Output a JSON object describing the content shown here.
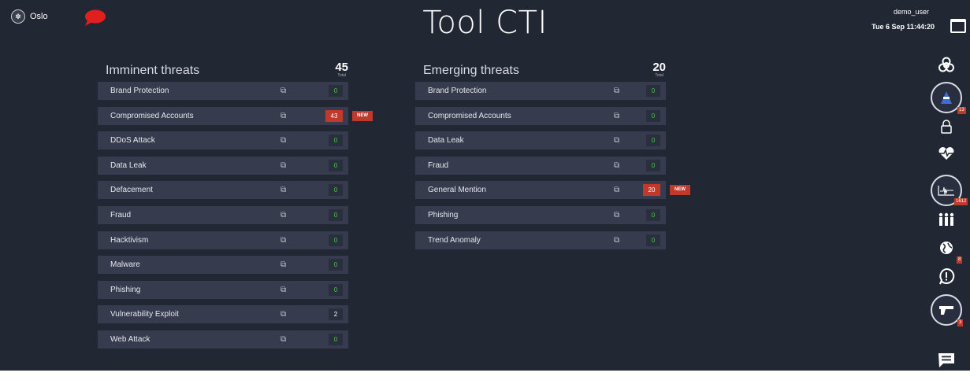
{
  "header": {
    "city": "Oslo",
    "title": "Tool CTI",
    "user": "demo_user",
    "datetime": "Tue 6 Sep 11:44:20"
  },
  "imminent": {
    "title": "Imminent threats",
    "total": "45",
    "total_label": "Total",
    "new_label": "NEW",
    "rows": [
      {
        "label": "Brand Protection",
        "count": "0",
        "status": "zero"
      },
      {
        "label": "Compromised Accounts",
        "count": "43",
        "status": "new"
      },
      {
        "label": "DDoS Attack",
        "count": "0",
        "status": "zero"
      },
      {
        "label": "Data Leak",
        "count": "0",
        "status": "zero"
      },
      {
        "label": "Defacement",
        "count": "0",
        "status": "zero"
      },
      {
        "label": "Fraud",
        "count": "0",
        "status": "zero"
      },
      {
        "label": "Hacktivism",
        "count": "0",
        "status": "zero"
      },
      {
        "label": "Malware",
        "count": "0",
        "status": "zero"
      },
      {
        "label": "Phishing",
        "count": "0",
        "status": "zero"
      },
      {
        "label": "Vulnerability Exploit",
        "count": "2",
        "status": "nonzero"
      },
      {
        "label": "Web Attack",
        "count": "0",
        "status": "zero"
      }
    ]
  },
  "emerging": {
    "title": "Emerging threats",
    "total": "20",
    "total_label": "Total",
    "new_label": "NEW",
    "rows": [
      {
        "label": "Brand Protection",
        "count": "0",
        "status": "zero"
      },
      {
        "label": "Compromised Accounts",
        "count": "0",
        "status": "zero"
      },
      {
        "label": "Data Leak",
        "count": "0",
        "status": "zero"
      },
      {
        "label": "Fraud",
        "count": "0",
        "status": "zero"
      },
      {
        "label": "General Mention",
        "count": "20",
        "status": "new"
      },
      {
        "label": "Phishing",
        "count": "0",
        "status": "zero"
      },
      {
        "label": "Trend Anomaly",
        "count": "0",
        "status": "zero"
      }
    ]
  },
  "sidebar": {
    "items": [
      {
        "icon": "biohazard-icon",
        "badge": ""
      },
      {
        "icon": "hacker-icon",
        "badge": "13"
      },
      {
        "icon": "lock-icon",
        "badge": ""
      },
      {
        "icon": "heartbeat-icon",
        "badge": ""
      },
      {
        "icon": "seismograph-icon",
        "badge": "1612"
      },
      {
        "icon": "people-icon",
        "badge": ""
      },
      {
        "icon": "globe-icon",
        "badge": "8"
      },
      {
        "icon": "alert-icon",
        "badge": ""
      },
      {
        "icon": "gun-icon",
        "badge": "3"
      },
      {
        "icon": "chat-icon",
        "badge": ""
      }
    ]
  },
  "colors": {
    "background": "#222734",
    "row": "#363b4d",
    "alert": "#c0392b",
    "ok": "#4cc24a"
  }
}
